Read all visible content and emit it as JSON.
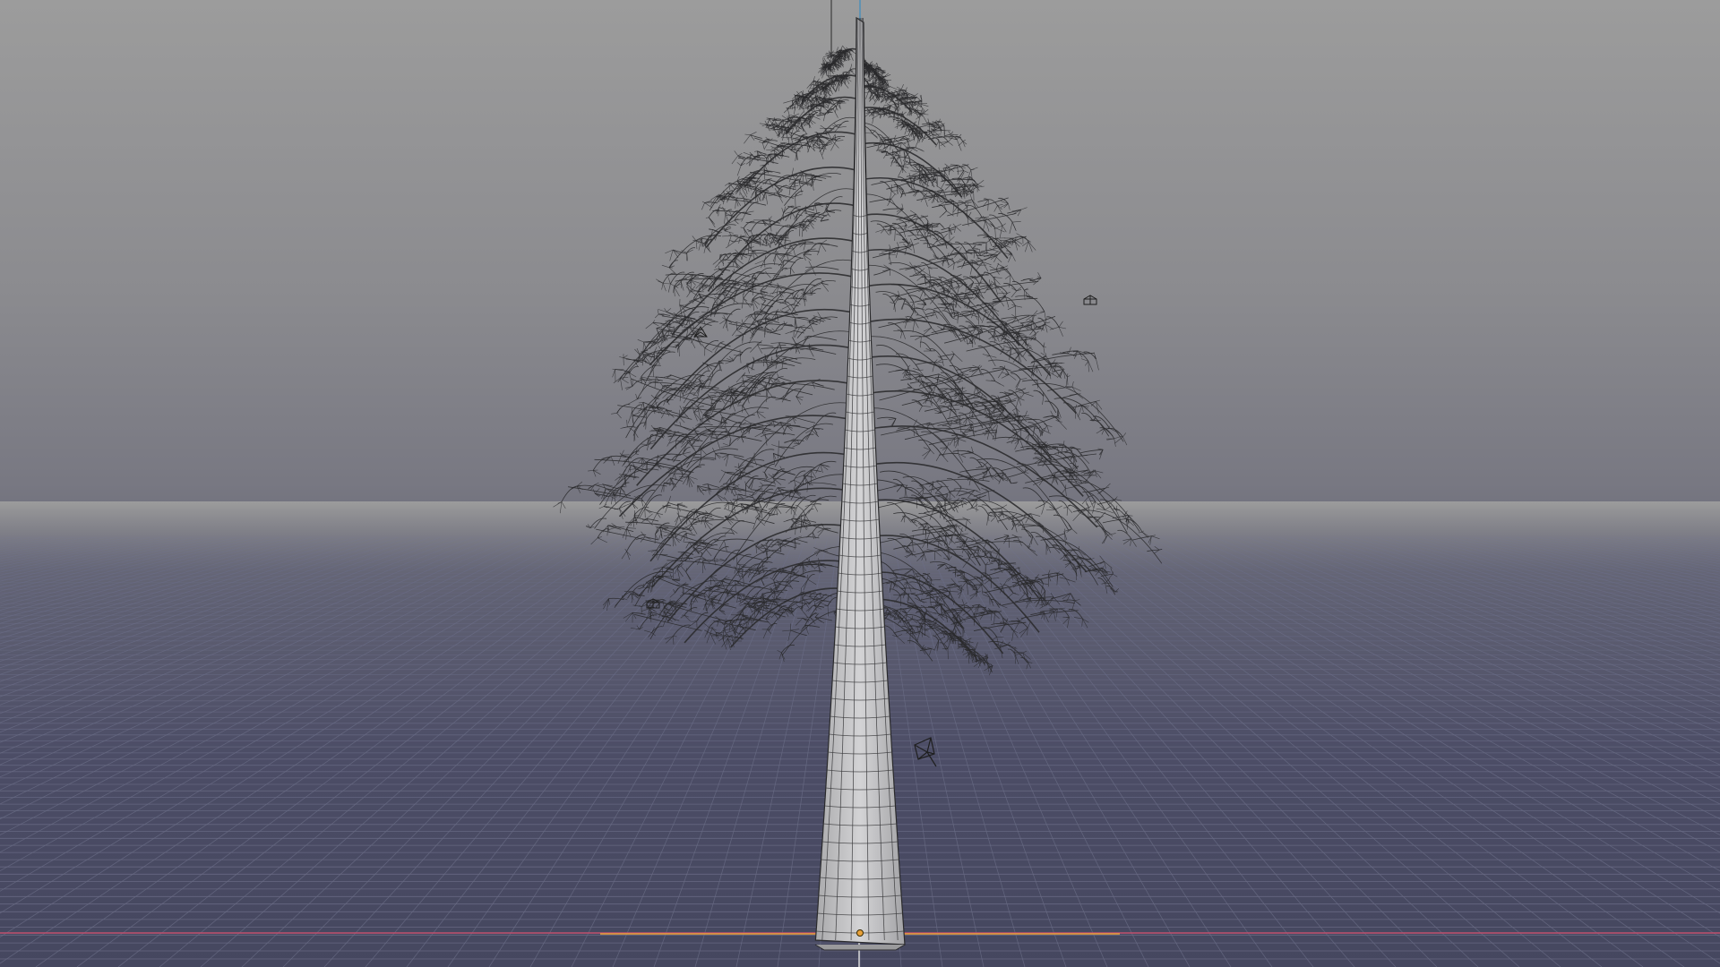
{
  "viewport": {
    "background_top": "#9c9c9c",
    "background_horizon": "#787882",
    "background_bottom": "#45475f",
    "grid_color": "#6a6c86",
    "x_axis_color": "#c0506e",
    "y_axis_color": "#4f8fb8",
    "selection_color": "#e8a13a"
  },
  "scene": {
    "objects": [
      {
        "name": "tree-mesh",
        "display": "wireframe"
      },
      {
        "name": "light-probe-1"
      },
      {
        "name": "light-probe-2"
      },
      {
        "name": "light-probe-3"
      },
      {
        "name": "camera-object"
      }
    ]
  }
}
